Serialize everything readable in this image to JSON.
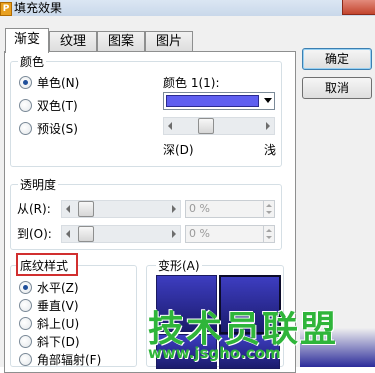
{
  "window": {
    "title": "填充效果"
  },
  "tabs": [
    {
      "label": "渐变",
      "active": true
    },
    {
      "label": "纹理",
      "active": false
    },
    {
      "label": "图案",
      "active": false
    },
    {
      "label": "图片",
      "active": false
    }
  ],
  "buttons": {
    "ok": "确定",
    "cancel": "取消"
  },
  "colors_group": {
    "label": "颜色",
    "options": [
      "单色(N)",
      "双色(T)",
      "预设(S)"
    ],
    "selected_index": 0,
    "color1_label": "颜色 1(1):",
    "color1_value": "#5f5ff0",
    "dark_label": "深(D)",
    "light_label": "浅",
    "slider_fraction": 0.3
  },
  "transparency_group": {
    "label": "透明度",
    "from_label": "从(R):",
    "to_label": "到(O):",
    "from_value": "0 %",
    "to_value": "0 %"
  },
  "shading_group": {
    "label": "底纹样式",
    "options": [
      "水平(Z)",
      "垂直(V)",
      "斜上(U)",
      "斜下(D)",
      "角部辐射(F)"
    ],
    "selected_index": 0
  },
  "variants_group": {
    "label": "变形(A)"
  },
  "watermark": {
    "main": "技术员联盟",
    "url": "www.jsgho.com"
  }
}
